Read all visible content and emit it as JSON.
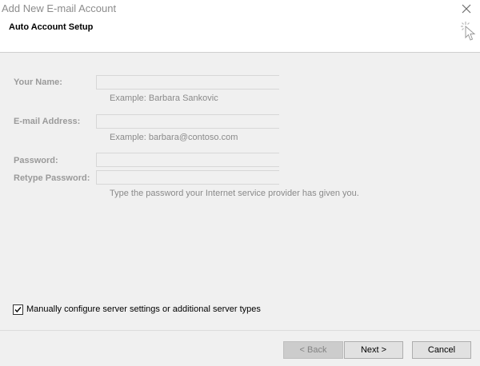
{
  "window": {
    "title": "Add New E-mail Account",
    "close_icon": "close-icon"
  },
  "header": {
    "title": "Auto Account Setup",
    "icon": "setup-wizard-cursor-icon"
  },
  "form": {
    "your_name": {
      "label": "Your Name:",
      "value": "",
      "hint": "Example: Barbara Sankovic"
    },
    "email_address": {
      "label": "E-mail Address:",
      "value": "",
      "hint": "Example: barbara@contoso.com"
    },
    "password": {
      "label": "Password:",
      "value": ""
    },
    "retype_password": {
      "label": "Retype Password:",
      "value": "",
      "hint": "Type the password your Internet service provider has given you."
    }
  },
  "manual_config": {
    "label": "Manually configure server settings or additional server types",
    "checked": true
  },
  "buttons": {
    "back": "< Back",
    "next": "Next >",
    "cancel": "Cancel"
  },
  "colors": {
    "background": "#f0f0f0",
    "header_background": "#ffffff",
    "disabled_text": "#9a9a9a"
  }
}
